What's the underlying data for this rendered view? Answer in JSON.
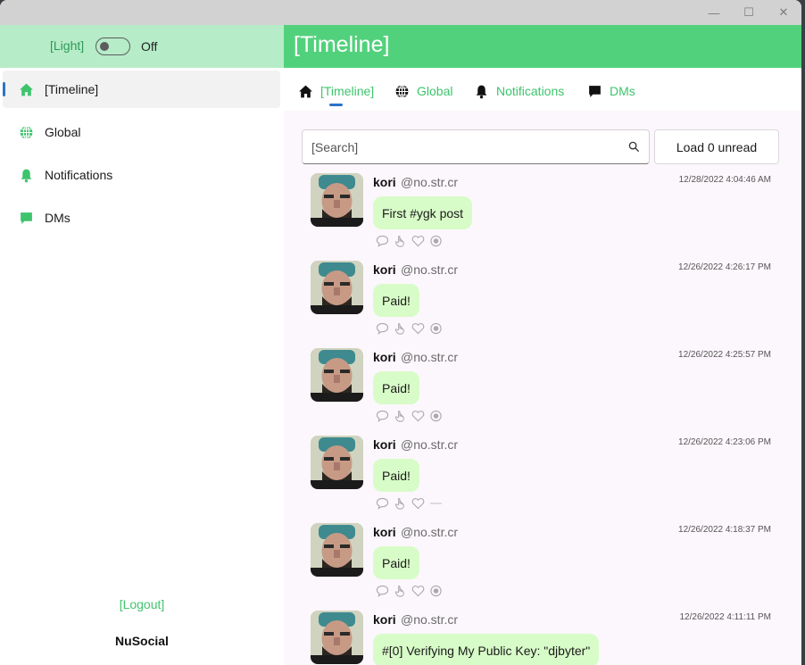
{
  "window": {
    "minimize_glyph": "—",
    "maximize_glyph": "☐",
    "close_glyph": "✕"
  },
  "theme": {
    "label": "[Light]",
    "state": "Off"
  },
  "sidebar": {
    "items": [
      {
        "label": "[Timeline]",
        "icon": "home-icon",
        "active": true
      },
      {
        "label": "Global",
        "icon": "globe-icon",
        "active": false
      },
      {
        "label": "Notifications",
        "icon": "bell-icon",
        "active": false
      },
      {
        "label": "DMs",
        "icon": "chat-icon",
        "active": false
      }
    ],
    "logout": "[Logout]",
    "brand": "NuSocial"
  },
  "header": {
    "title": "[Timeline]"
  },
  "tabs": [
    {
      "label": "[Timeline]",
      "icon": "home-icon",
      "active": true
    },
    {
      "label": "Global",
      "icon": "globe-icon",
      "active": false
    },
    {
      "label": "Notifications",
      "icon": "bell-icon",
      "active": false
    },
    {
      "label": "DMs",
      "icon": "chat-icon",
      "active": false
    }
  ],
  "search": {
    "placeholder": "[Search]"
  },
  "load_button": "Load 0 unread",
  "posts": [
    {
      "author": "kori",
      "handle": "@no.str.cr",
      "time": "12/28/2022 4:04:46 AM",
      "text": "First #ygk post",
      "zap": true
    },
    {
      "author": "kori",
      "handle": "@no.str.cr",
      "time": "12/26/2022 4:26:17 PM",
      "text": "Paid!",
      "zap": true
    },
    {
      "author": "kori",
      "handle": "@no.str.cr",
      "time": "12/26/2022 4:25:57 PM",
      "text": "Paid!",
      "zap": true
    },
    {
      "author": "kori",
      "handle": "@no.str.cr",
      "time": "12/26/2022 4:23:06 PM",
      "text": "Paid!",
      "zap": false
    },
    {
      "author": "kori",
      "handle": "@no.str.cr",
      "time": "12/26/2022 4:18:37 PM",
      "text": "Paid!",
      "zap": true
    },
    {
      "author": "kori",
      "handle": "@no.str.cr",
      "time": "12/26/2022 4:11:11 PM",
      "text": "#[0] Verifying My Public Key: \"djbyter\"",
      "zap": true
    }
  ],
  "colors": {
    "accent": "#52d17c",
    "accent_text": "#3dc46c",
    "sidebar_top": "#b6ecc8",
    "bubble": "#d8fcc8",
    "indicator": "#2a73c8"
  }
}
